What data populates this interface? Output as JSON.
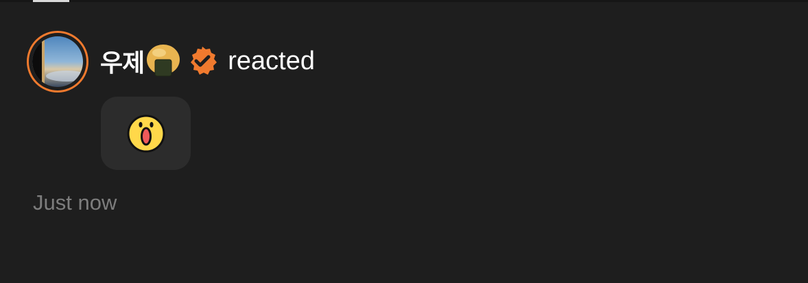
{
  "notification": {
    "username": "우제",
    "username_emoji": "rice-ball-emoji",
    "verified_badge": "verified-badge-icon",
    "action": "reacted",
    "reaction_emoji": "surprised-face-emoji",
    "timestamp": "Just now"
  },
  "colors": {
    "background": "#1e1e1e",
    "accent": "#f07a2e",
    "reaction_box": "#2c2c2c",
    "muted_text": "#7d7d7d"
  }
}
